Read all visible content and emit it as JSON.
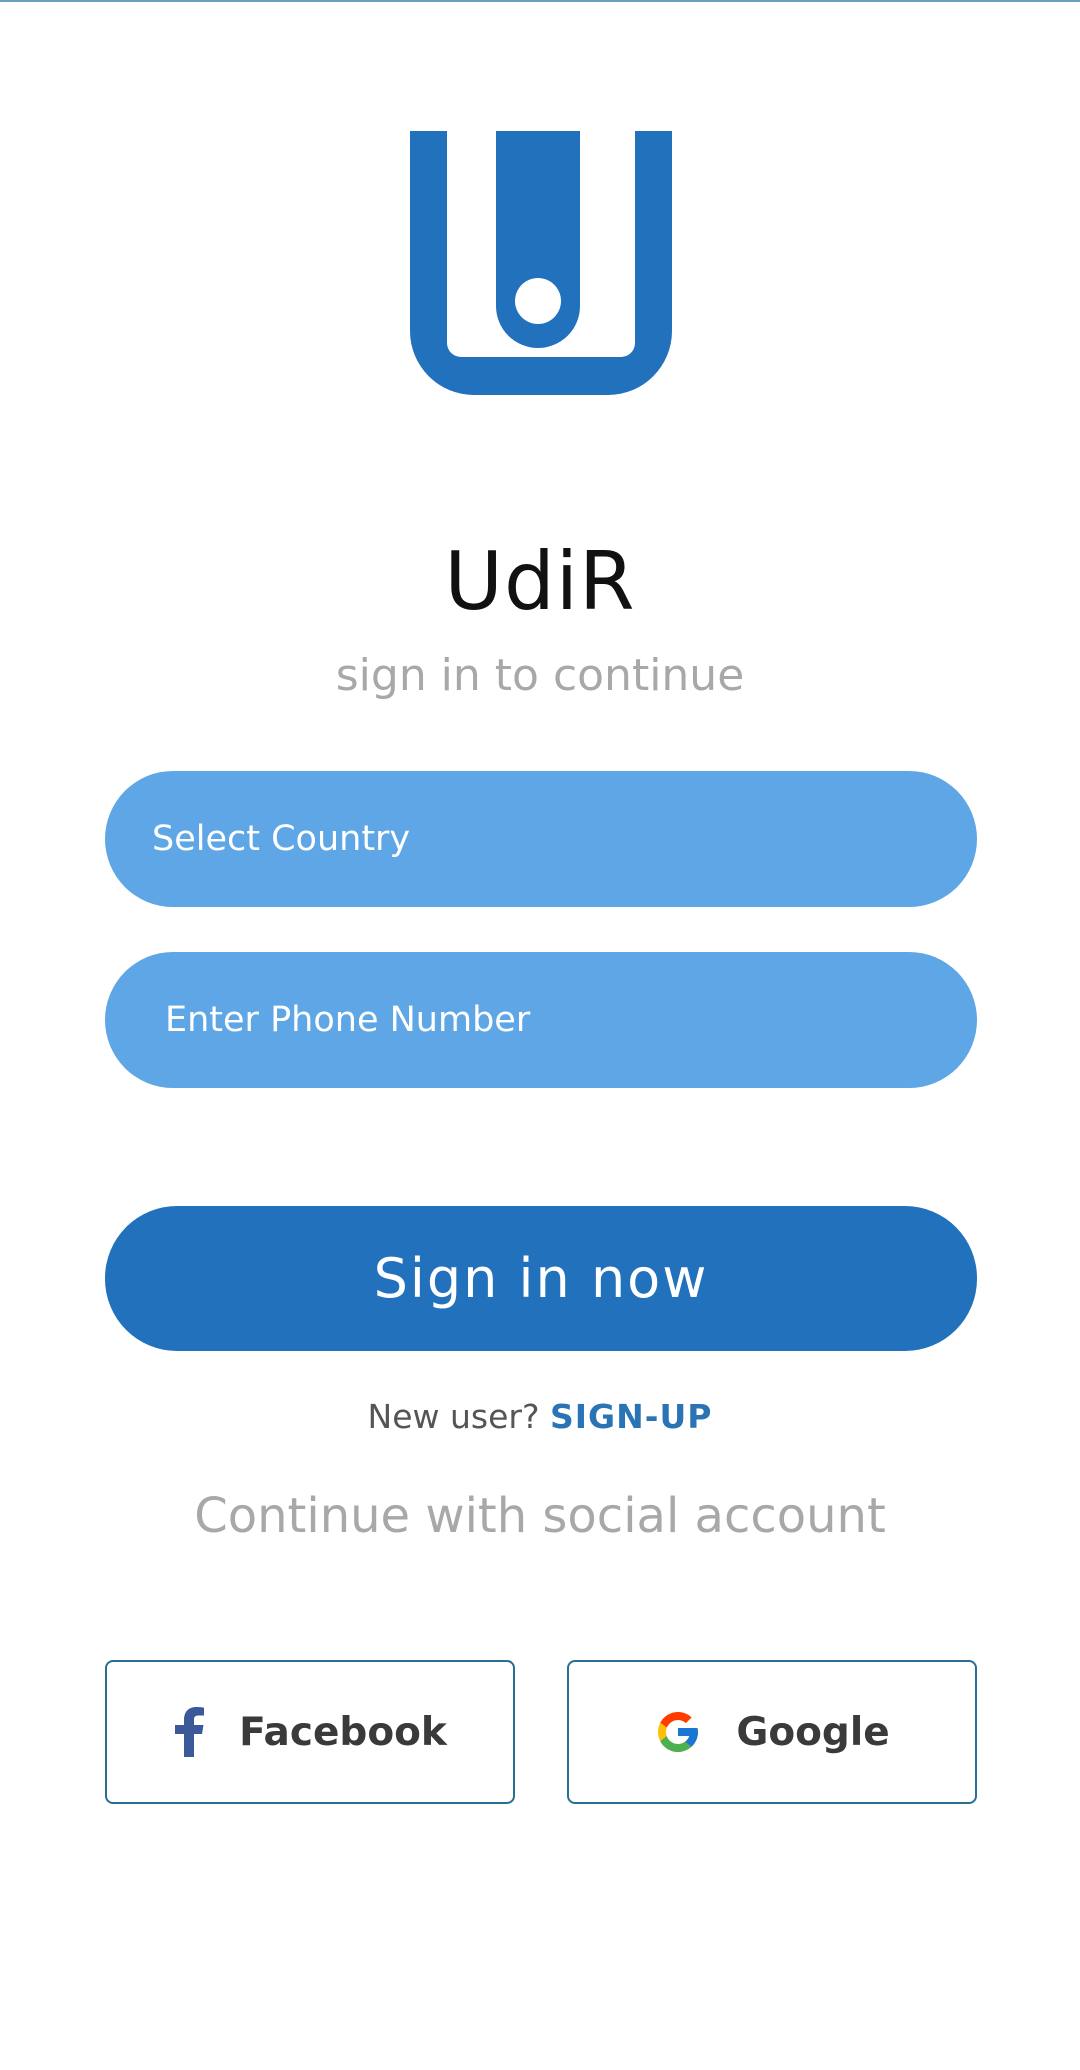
{
  "app": {
    "title": "UdiR",
    "subtitle": "sign in to continue",
    "logo_icon": "udir-logo-icon"
  },
  "form": {
    "country_placeholder": "Select Country",
    "phone_placeholder": "Enter Phone Number",
    "signin_label": "Sign in now"
  },
  "signup": {
    "prompt": "New user?",
    "link_label": "SIGN-UP"
  },
  "social": {
    "heading": "Continue with social account",
    "facebook_label": "Facebook",
    "facebook_icon": "facebook-icon",
    "google_label": "Google",
    "google_icon": "google-icon"
  },
  "colors": {
    "brand": "#2271bc",
    "field": "#5ea6e5",
    "link": "#2a74b5",
    "muted": "#a8a8a8"
  }
}
